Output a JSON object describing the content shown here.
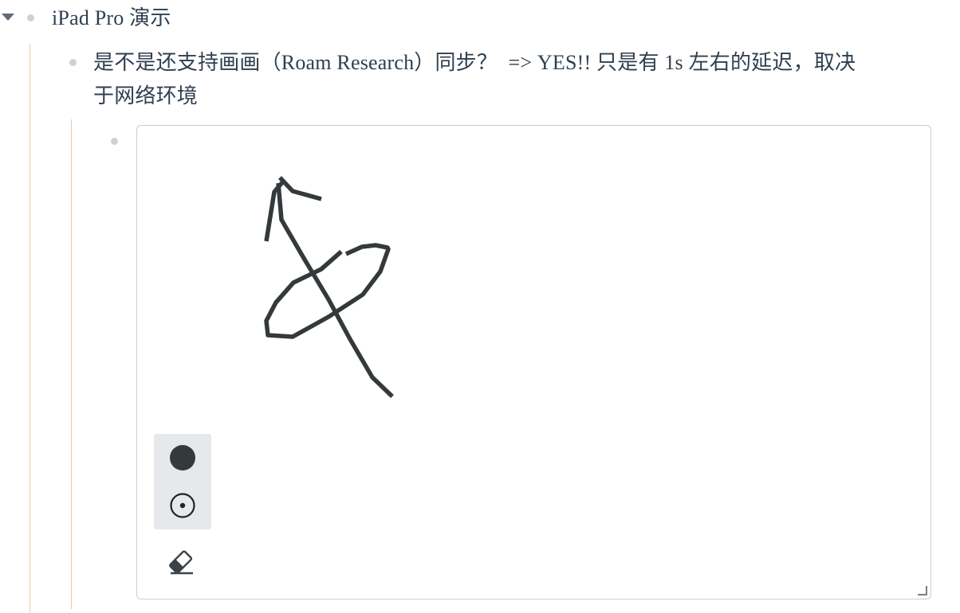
{
  "root_block": {
    "text": "iPad Pro 演示"
  },
  "child_block": {
    "line1": "是不是还支持画画（Roam Research）同步？  => YES!! 只是有 1s 左右的延迟，取决",
    "line2": "于网络环境"
  },
  "drawing": {
    "stroke_color": "#343a3c",
    "tools": {
      "brush_icon": "filled-circle-icon",
      "pen_icon": "dot-circle-icon",
      "eraser_icon": "eraser-icon"
    }
  }
}
